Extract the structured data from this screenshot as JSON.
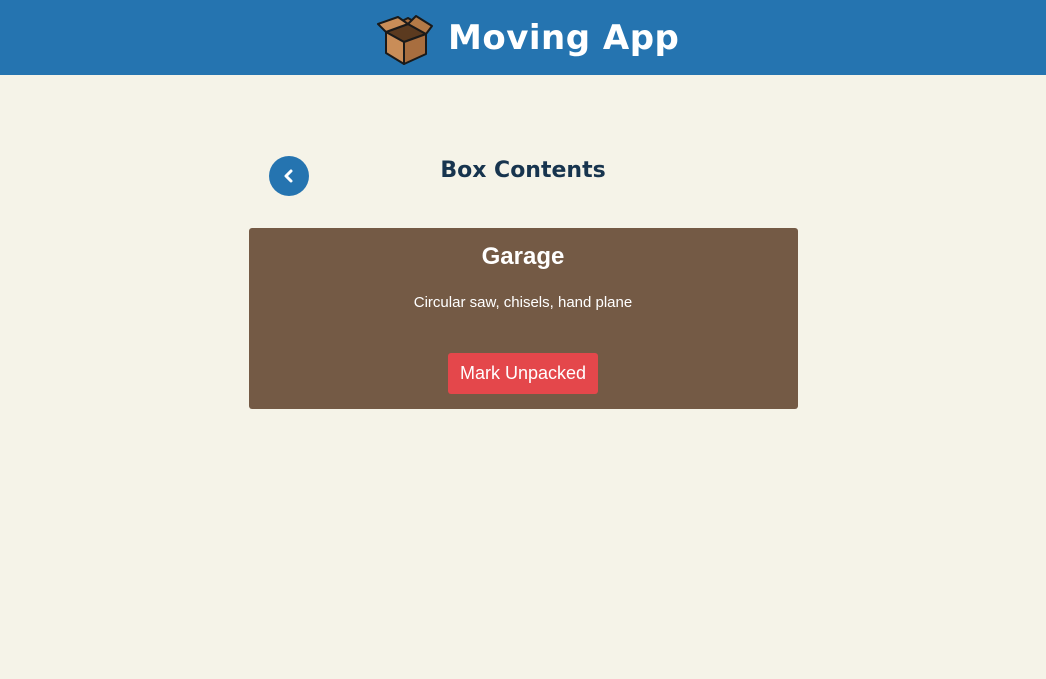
{
  "header": {
    "app_title": "Moving App",
    "logo_icon": "cardboard-box-icon",
    "background_color": "#2574b0"
  },
  "page": {
    "title": "Box Contents",
    "back_icon": "chevron-left-icon"
  },
  "box": {
    "room": "Garage",
    "contents": "Circular saw, chisels, hand plane",
    "action_label": "Mark Unpacked",
    "card_color": "#745a45",
    "action_color": "#e4474b"
  }
}
